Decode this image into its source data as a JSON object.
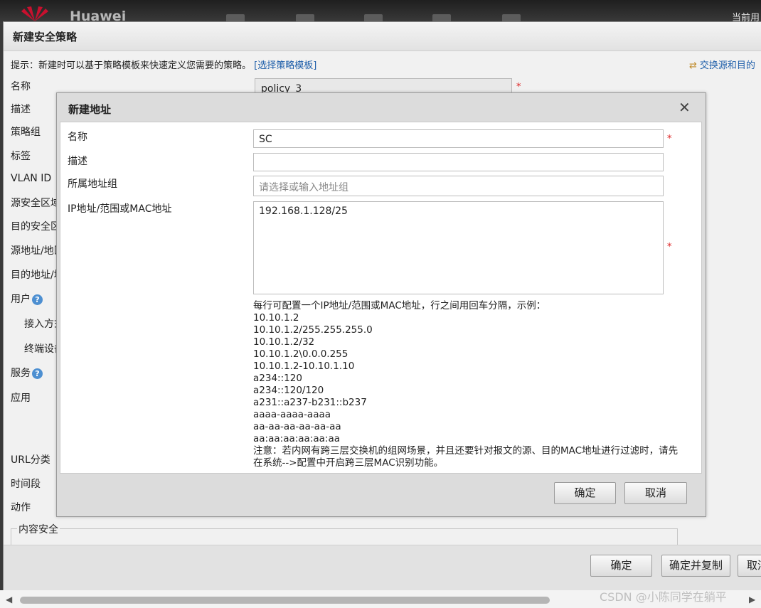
{
  "topbar": {
    "brand": "Huawei",
    "user_label": "当前用"
  },
  "outer_dialog": {
    "title": "新建安全策略",
    "hint_prefix": "提示：新建时可以基于策略模板来快速定义您需要的策略。",
    "template_link": "[选择策略模板]",
    "swap_link": "交换源和目的",
    "name_value": "policy_3",
    "labels": {
      "name": "名称",
      "desc": "描述",
      "group": "策略组",
      "tag": "标签",
      "vlan": "VLAN ID",
      "src_zone": "源安全区域",
      "dst_zone": "目的安全区域",
      "src_addr": "源地址/地区",
      "dst_addr": "目的地址/地区",
      "user": "用户",
      "access": "接入方式",
      "terminal": "终端设备",
      "service": "服务",
      "app": "应用",
      "url": "URL分类",
      "time": "时间段",
      "action": "动作",
      "content_security": "内容安全"
    },
    "buttons": {
      "ok": "确定",
      "ok_copy": "确定并复制",
      "cancel": "取消"
    }
  },
  "inner_dialog": {
    "title": "新建地址",
    "name_label": "名称",
    "name_value": "SC",
    "desc_label": "描述",
    "desc_value": "",
    "group_label": "所属地址组",
    "group_placeholder": "请选择或输入地址组",
    "ip_label": "IP地址/范围或MAC地址",
    "ip_value": "192.168.1.128/25",
    "help_lines": [
      "每行可配置一个IP地址/范围或MAC地址，行之间用回车分隔，示例：",
      "10.10.1.2",
      "10.10.1.2/255.255.255.0",
      "10.10.1.2/32",
      "10.10.1.2\\0.0.0.255",
      "10.10.1.2-10.10.1.10",
      "a234::120",
      "a234::120/120",
      "a231::a237-b231::b237",
      "aaaa-aaaa-aaaa",
      "aa-aa-aa-aa-aa-aa",
      "aa:aa:aa:aa:aa:aa"
    ],
    "note": "注意：若内网有跨三层交换机的组网场景，并且还要针对报文的源、目的MAC地址进行过滤时，请先在系统-->配置中开启跨三层MAC识别功能。",
    "buttons": {
      "ok": "确定",
      "cancel": "取消"
    }
  },
  "watermark": "CSDN @小陈同学在躺平",
  "required_mark": "*"
}
